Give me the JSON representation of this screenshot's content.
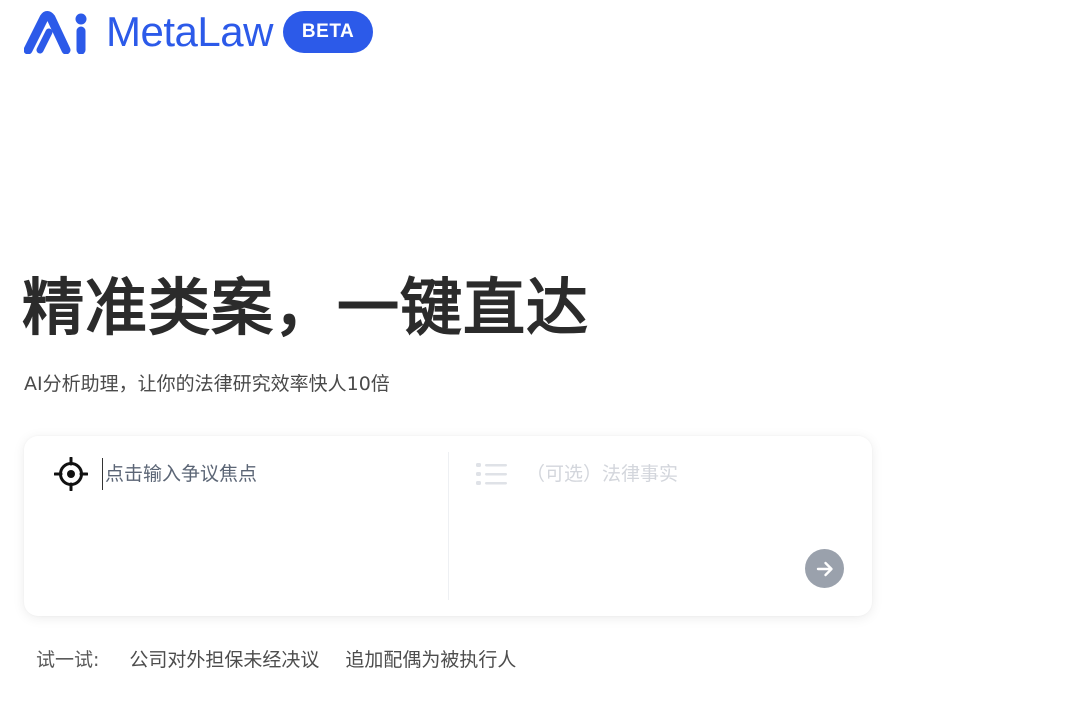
{
  "brand": {
    "name": "MetaLaw",
    "badge": "BETA",
    "logo_icon": "metalaw-logo-icon",
    "accent_color": "#2c5ae9"
  },
  "hero": {
    "title": "精准类案，一键直达",
    "subtitle": "AI分析助理，让你的法律研究效率快人10倍"
  },
  "search": {
    "focus_icon": "target-icon",
    "focus_placeholder": "点击输入争议焦点",
    "facts_icon": "list-icon",
    "facts_placeholder": "（可选）法律事实",
    "submit_icon": "arrow-right-icon",
    "submit_color": "#9aa1ac"
  },
  "suggestions": {
    "label": "试一试:",
    "items": [
      "公司对外担保未经决议",
      "追加配偶为被执行人"
    ]
  }
}
